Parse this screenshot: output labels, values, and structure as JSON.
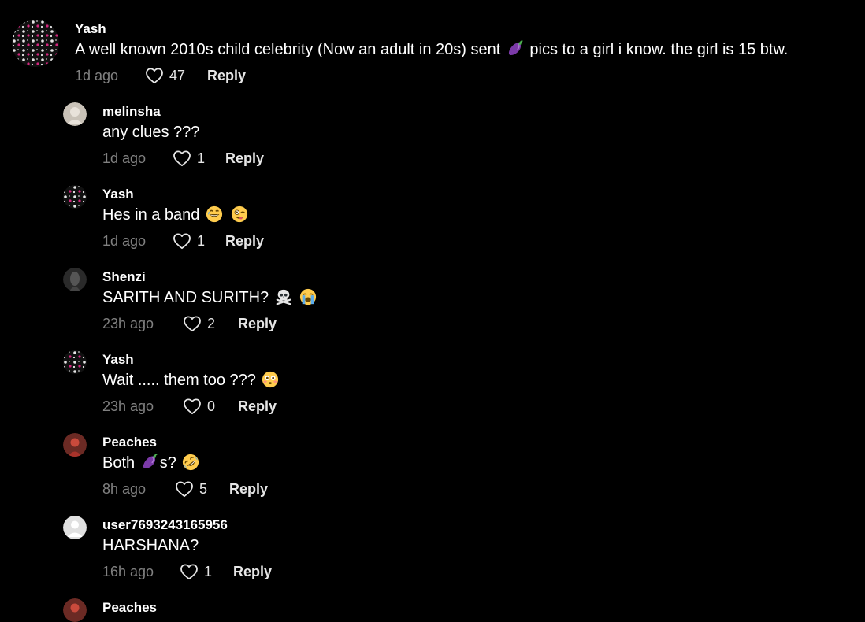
{
  "comments": [
    {
      "username": "Yash",
      "text_before": "A well known 2010s child celebrity (Now an adult in 20s) sent",
      "text_after": "pics to a girl i know. the girl is 15 btw.",
      "time": "1d ago",
      "likes": "47",
      "reply_label": "Reply"
    },
    {
      "username": "melinsha",
      "text": "any clues ???",
      "time": "1d ago",
      "likes": "1",
      "reply_label": "Reply"
    },
    {
      "username": "Yash",
      "text": "Hes in a band",
      "time": "1d ago",
      "likes": "1",
      "reply_label": "Reply"
    },
    {
      "username": "Shenzi",
      "text": "SARITH AND SURITH?",
      "skull": "☠️",
      "time": "23h ago",
      "likes": "2",
      "reply_label": "Reply"
    },
    {
      "username": "Yash",
      "text": "Wait ..... them too ???",
      "time": "23h ago",
      "likes": "0",
      "reply_label": "Reply"
    },
    {
      "username": "Peaches",
      "text_before": "Both",
      "text_after": "s?",
      "time": "8h ago",
      "likes": "5",
      "reply_label": "Reply"
    },
    {
      "username": "user7693243165956",
      "text": "HARSHANA?",
      "time": "16h ago",
      "likes": "1",
      "reply_label": "Reply"
    },
    {
      "username": "Peaches"
    }
  ],
  "icons": {
    "like": "heart-outline-icon",
    "eggplant": "eggplant-emoji",
    "grin_sweat": "grinning-sweat-emoji",
    "wink": "winking-tongue-emoji",
    "skull": "skull-crossbones-emoji",
    "crying": "loudly-crying-emoji",
    "flushed": "flushed-face-emoji",
    "rofl": "rolling-on-floor-laughing-emoji"
  },
  "colors": {
    "background": "#000000",
    "text": "#ffffff",
    "muted": "#8a8a8a"
  }
}
